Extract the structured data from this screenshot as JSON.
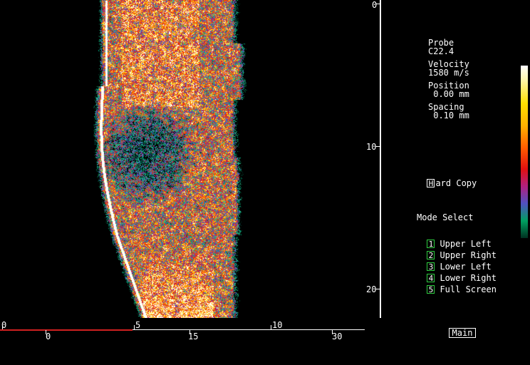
{
  "info": {
    "probe_label": "Probe",
    "probe_value": "C22.4",
    "velocity_label": "Velocity",
    "velocity_value": "1580 m/s",
    "position_label": "Position",
    "position_value": " 0.00 mm",
    "spacing_label": "Spacing",
    "spacing_value": " 0.10 mm"
  },
  "hard_copy": {
    "key": "H",
    "label": "ard Copy"
  },
  "mode_select": {
    "title": "Mode Select",
    "items": [
      {
        "key": "1",
        "label": "Upper Left"
      },
      {
        "key": "2",
        "label": "Upper Right"
      },
      {
        "key": "3",
        "label": "Lower Left"
      },
      {
        "key": "4",
        "label": "Lower Right"
      },
      {
        "key": "5",
        "label": "Full Screen"
      }
    ]
  },
  "main_button": "Main",
  "depth_axis": {
    "labels": [
      "0",
      "10",
      "20"
    ]
  },
  "lateral_axis": {
    "upper_labels": [
      "0",
      "5",
      "10"
    ],
    "lower_labels": [
      "0",
      "15",
      "30"
    ]
  },
  "colors": {
    "key_border": "#2ecc40",
    "axis_highlight": "#d02020"
  }
}
